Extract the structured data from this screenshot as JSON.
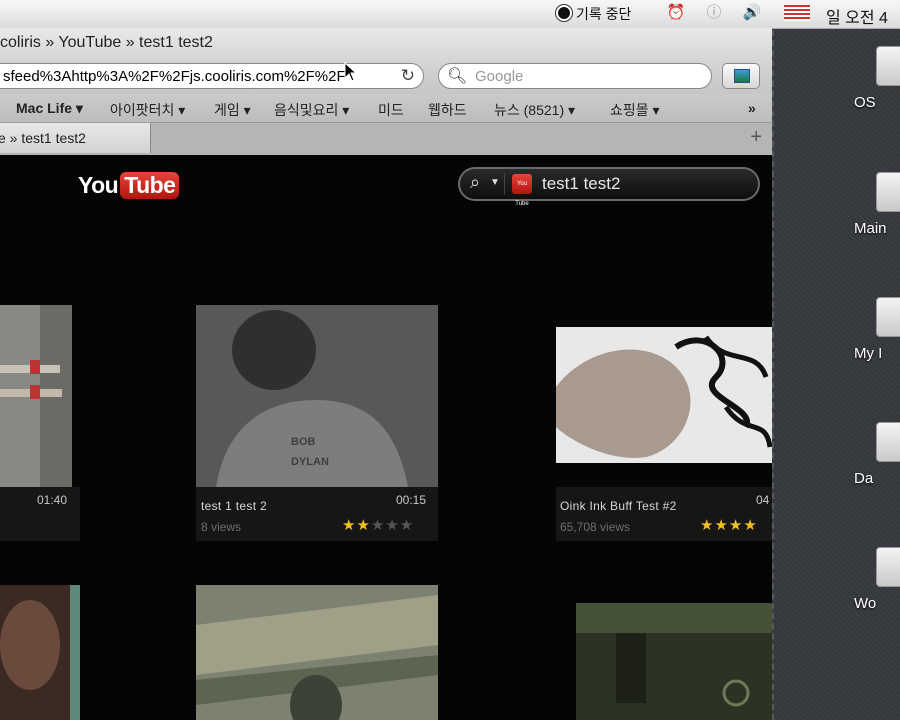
{
  "menubar": {
    "record_label": "기록 중단",
    "clock_partial": "일 오전 4"
  },
  "browser": {
    "title": "coliris » YouTube » test1 test2",
    "url": "sfeed%3Ahttp%3A%2F%2Fjs.cooliris.com%2F%2F",
    "search_placeholder": "Google",
    "bookmarks": [
      {
        "label": "Mac Life ▾"
      },
      {
        "label": "아이팟터치 ▾"
      },
      {
        "label": "게임 ▾"
      },
      {
        "label": "음식및요리 ▾"
      },
      {
        "label": "미드"
      },
      {
        "label": "웹하드"
      },
      {
        "label": "뉴스 (8521) ▾"
      },
      {
        "label": "쇼핑몰 ▾"
      }
    ],
    "bookmarks_overflow": "»",
    "tab_title": "e » test1 test2",
    "tab_add": "+"
  },
  "content": {
    "logo_you": "You",
    "logo_tube": "Tube",
    "search_query": "test1 test2",
    "yt_mini": "You Tube",
    "videos": [
      {
        "title": "",
        "duration": "01:40",
        "views": "",
        "rating": 0
      },
      {
        "title": "test 1 test 2",
        "duration": "00:15",
        "views": "8 views",
        "rating": 2
      },
      {
        "title": "Oink Ink Buff Test #2",
        "duration": "04",
        "views": "65,708 views",
        "rating": 4
      }
    ]
  },
  "desktop": {
    "items": [
      {
        "label": "OS"
      },
      {
        "label": "Main"
      },
      {
        "label": "My I"
      },
      {
        "label": "Da"
      },
      {
        "label": "Wo"
      }
    ]
  },
  "colors": {
    "youtube_red": "#cc181e",
    "star_gold": "#f0c020",
    "page_bg": "#050505"
  }
}
